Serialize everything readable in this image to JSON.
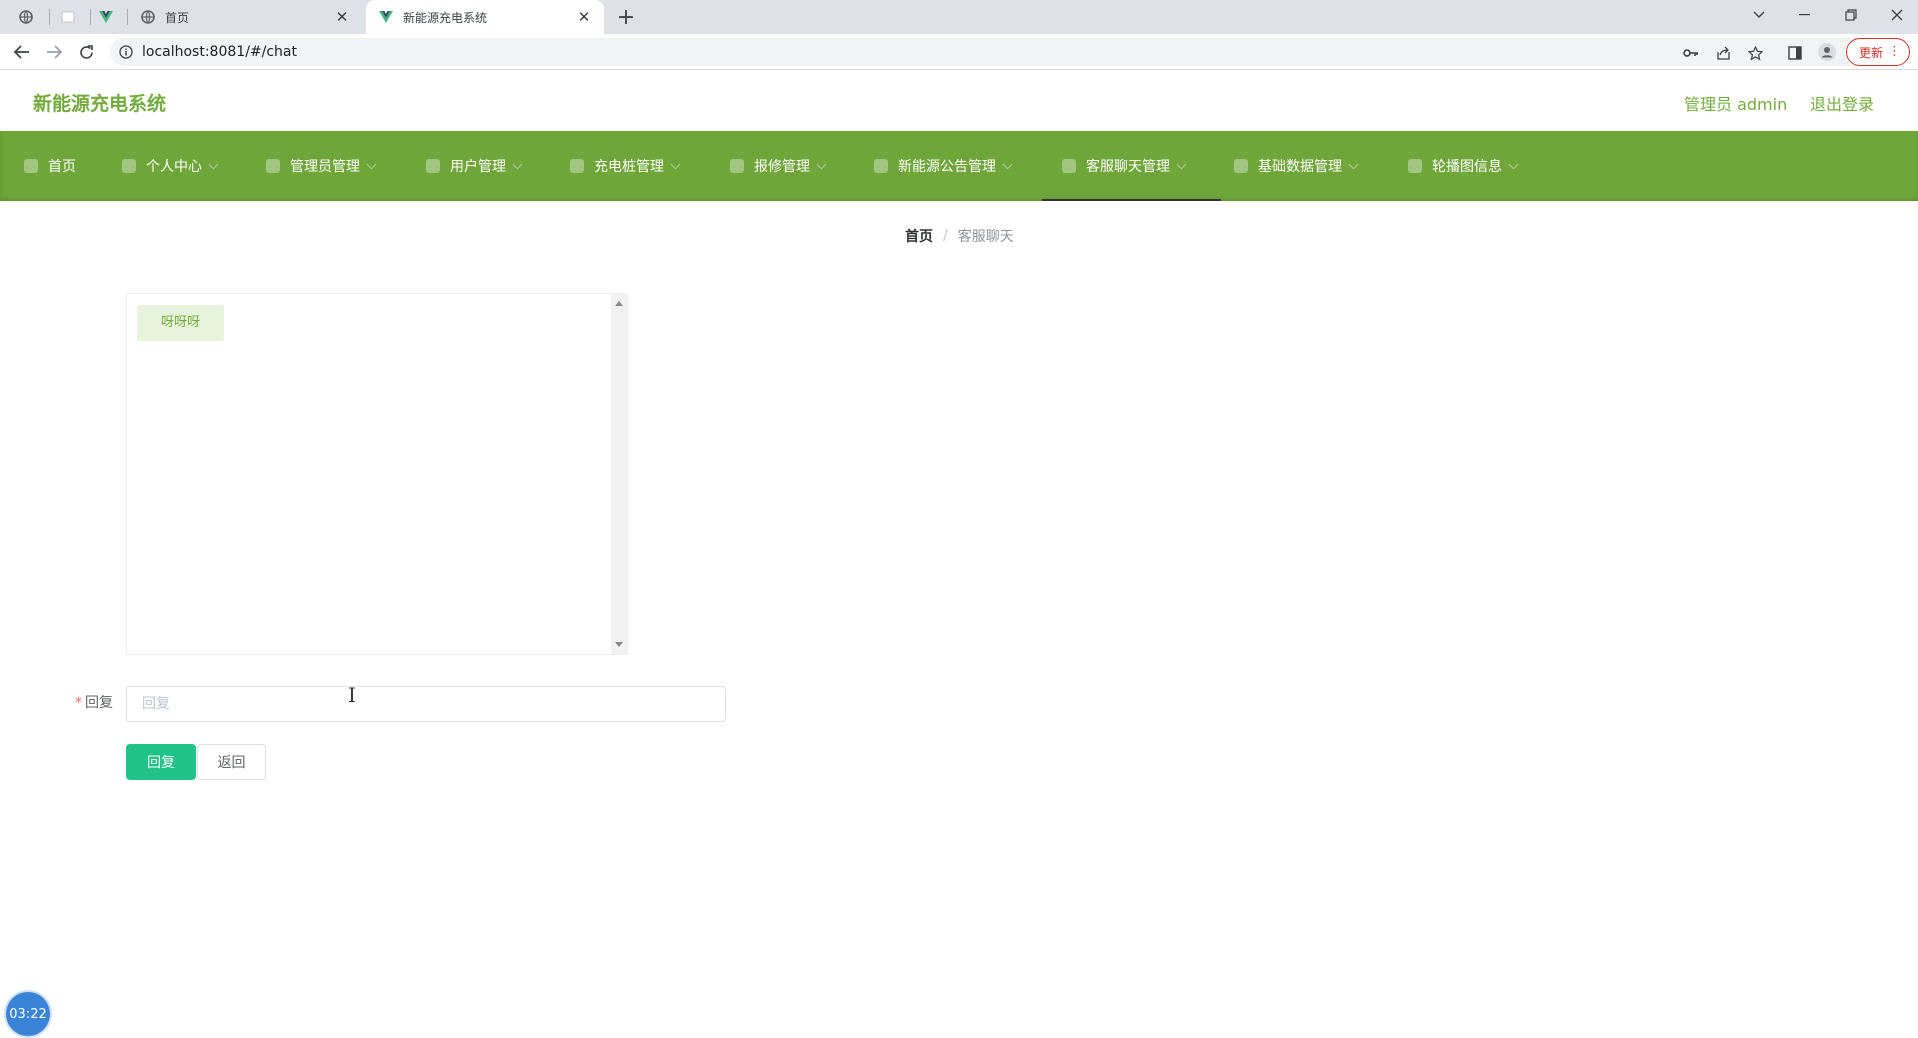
{
  "browser": {
    "tabs": [
      {
        "title": "首页",
        "favicon": "globe-icon",
        "active": false
      },
      {
        "title": "新能源充电系统",
        "favicon": "vue-logo-icon",
        "active": true
      }
    ],
    "new_tab_label": "+",
    "url": "localhost:8081/#/chat",
    "update_label": "更新"
  },
  "header": {
    "title": "新能源充电系统",
    "admin_label": "管理员 admin",
    "logout_label": "退出登录",
    "accent_color": "#75ab3e"
  },
  "menu": {
    "bar_color": "#6fa63a",
    "items": [
      {
        "label": "首页",
        "icon": "home-icon"
      },
      {
        "label": "个人中心",
        "icon": "user-icon"
      },
      {
        "label": "管理员管理",
        "icon": "admin-icon"
      },
      {
        "label": "用户管理",
        "icon": "users-icon"
      },
      {
        "label": "充电桩管理",
        "icon": "charger-icon"
      },
      {
        "label": "报修管理",
        "icon": "repair-icon"
      },
      {
        "label": "新能源公告管理",
        "icon": "notice-icon"
      },
      {
        "label": "客服聊天管理",
        "icon": "chat-icon",
        "active": true
      },
      {
        "label": "基础数据管理",
        "icon": "data-icon"
      },
      {
        "label": "轮播图信息",
        "icon": "image-icon"
      }
    ]
  },
  "breadcrumb": {
    "home": "首页",
    "separator": "/",
    "current": "客服聊天"
  },
  "chat": {
    "messages": [
      {
        "text": "呀呀呀"
      }
    ]
  },
  "form": {
    "reply_label": "回复",
    "required_mark": "*",
    "reply_placeholder": "回复",
    "reply_value": "",
    "submit_label": "回复",
    "back_label": "返回",
    "submit_color": "#20c289"
  },
  "clock": {
    "time": "03:22"
  }
}
